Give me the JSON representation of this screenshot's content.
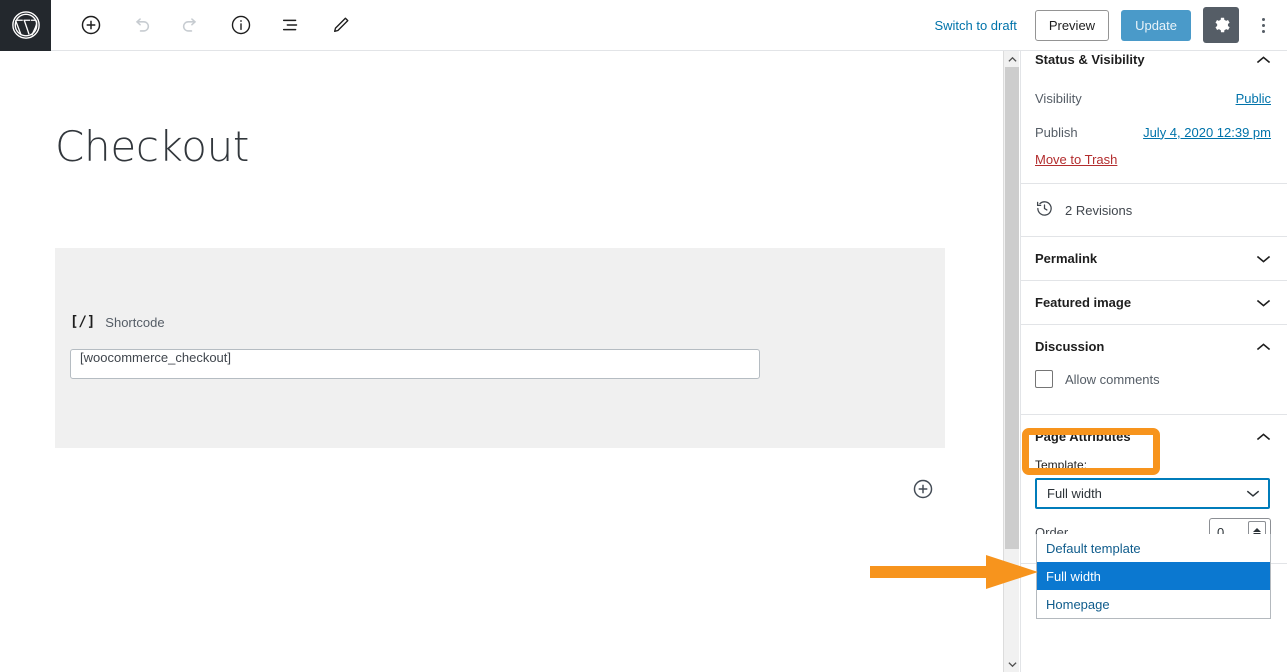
{
  "topbar": {
    "logo_icon": "wordpress-logo-icon",
    "tools": [
      {
        "name": "add-block-button",
        "icon": "plus-circle-icon",
        "disabled": false
      },
      {
        "name": "undo-button",
        "icon": "undo-arrow-icon",
        "disabled": true
      },
      {
        "name": "redo-button",
        "icon": "redo-arrow-icon",
        "disabled": true
      },
      {
        "name": "details-button",
        "icon": "info-circle-icon",
        "disabled": false
      },
      {
        "name": "list-view-button",
        "icon": "list-view-icon",
        "disabled": false
      },
      {
        "name": "edit-mode-button",
        "icon": "pencil-icon",
        "disabled": false
      }
    ],
    "switch_to_draft": "Switch to draft",
    "preview": "Preview",
    "update": "Update",
    "settings_icon": "gear-icon",
    "more_icon": "three-dots-vertical-icon"
  },
  "editor": {
    "title": "Checkout",
    "block": {
      "icon_text": "[/]",
      "label": "Shortcode",
      "value": "[woocommerce_checkout]"
    },
    "add_block_icon": "plus-circle-icon"
  },
  "sidebar": {
    "status": {
      "title": "Status & Visibility",
      "visibility_label": "Visibility",
      "visibility_value": "Public",
      "publish_label": "Publish",
      "publish_value": "July 4, 2020 12:39 pm",
      "trash_label": "Move to Trash"
    },
    "revisions": {
      "icon": "history-clock-icon",
      "label": "2 Revisions"
    },
    "permalink": {
      "title": "Permalink",
      "state": "collapsed"
    },
    "featured_image": {
      "title": "Featured image",
      "state": "collapsed"
    },
    "discussion": {
      "title": "Discussion",
      "state": "expanded",
      "allow_comments_label": "Allow comments",
      "allow_comments_checked": false
    },
    "page_attributes": {
      "title": "Page Attributes",
      "state": "expanded",
      "template_label": "Template:",
      "template_value": "Full width",
      "template_options": [
        {
          "label": "Default template",
          "selected": false
        },
        {
          "label": "Full width",
          "selected": true
        },
        {
          "label": "Homepage",
          "selected": false
        }
      ],
      "order_label": "Order",
      "order_value": "0"
    }
  },
  "annotations": {
    "highlight_color": "#f7941d",
    "box_target": "Page Attributes",
    "arrow_target": "Full width"
  }
}
